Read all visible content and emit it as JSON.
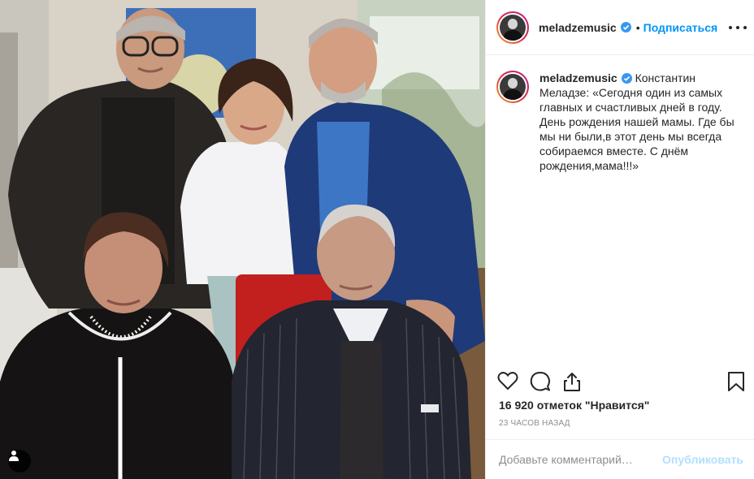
{
  "post": {
    "username": "meladzemusic",
    "follow_label": "Подписаться",
    "caption_lines": [
      "Константин",
      "Меладзе: «Сегодня один из самых",
      "главных и счастливых дней в году.",
      "День рождения нашей мамы. Где бы",
      "мы ни были,в этот день мы всегда",
      "собираемся вместе. С днём",
      "рождения,мама!!!»"
    ],
    "likes": "16 920 отметок \"Нравится\"",
    "time": "23 ЧАСОВ НАЗАД",
    "comment_placeholder": "Добавьте комментарий…",
    "publish_label": "Опубликовать"
  },
  "icons": {
    "verified": "verified-badge-icon",
    "more": "more-options-icon",
    "like": "heart-icon",
    "comment": "comment-icon",
    "share": "share-icon",
    "save": "bookmark-icon",
    "tag": "user-tag-icon"
  },
  "colors": {
    "accent": "#0095f6",
    "publish_disabled": "#b2dffc",
    "secondary_text": "#8e8e8e"
  }
}
